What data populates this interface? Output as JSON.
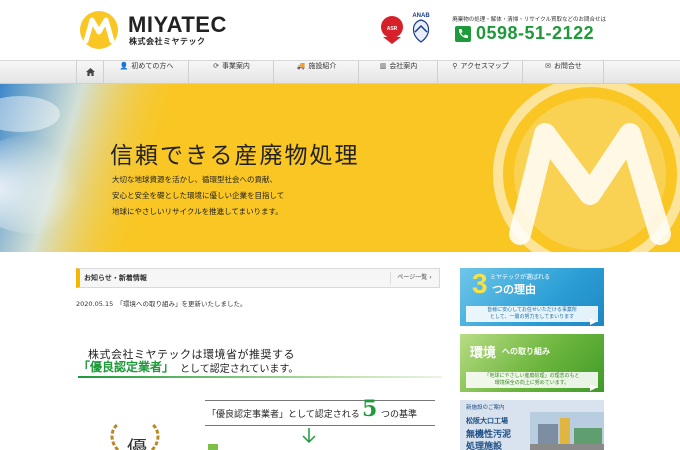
{
  "header": {
    "logo_name": "MIYATEC",
    "logo_sub": "株式会社ミヤテック",
    "badge_asr": "ASR",
    "badge_anab": "ANAB",
    "contact_note": "廃棄物の処理・解体・清掃・リサイクル買取などのお問合せは",
    "phone": "0598-51-2122"
  },
  "nav": {
    "items": [
      {
        "label": "初めての方へ",
        "icon": "user-icon",
        "glyph": "👤"
      },
      {
        "label": "事業案内",
        "icon": "refresh-icon",
        "glyph": "⟳"
      },
      {
        "label": "施設紹介",
        "icon": "truck-icon",
        "glyph": "🚚"
      },
      {
        "label": "会社案内",
        "icon": "building-icon",
        "glyph": "▥"
      },
      {
        "label": "アクセスマップ",
        "icon": "map-marker-icon",
        "glyph": "⚲"
      },
      {
        "label": "お問合せ",
        "icon": "mail-icon",
        "glyph": "✉"
      }
    ]
  },
  "hero": {
    "title": "信頼できる産廃物処理",
    "lines": [
      "大切な地球資源を活かし、循環型社会への貢献、",
      "安心と安全を礎とした環境に優しい企業を目指して",
      "地球にやさしいリサイクルを推進してまいります。"
    ]
  },
  "news": {
    "title": "お知らせ・新着情報",
    "more": "ページ一覧",
    "entry": "2020.05.15　「環境への取り組み」を更新いたしました。"
  },
  "certified": {
    "line1": "株式会社ミヤテックは環境省が推奨する",
    "highlight": "「優良認定業者」",
    "rest": "として認定されています。",
    "five_text": "「優良認定事業者」として認定される",
    "five_num": "5",
    "five_tail": "つの基準",
    "medal_char": "優"
  },
  "sidebar": {
    "banner1": {
      "top": "ミヤテックが選ばれる",
      "num": "3",
      "tail": "つの理由",
      "cap1": "皆様に安心してお任せいただける事業所",
      "cap2": "として、一層の努力をしてまいります"
    },
    "banner2": {
      "title": "環境",
      "tail": "への取り組み",
      "cap1": "「地球にやさしい産廃処理」の理念のもと",
      "cap2": "環境保全の向上に努めています。"
    },
    "banner3": {
      "top": "新施設のご案内",
      "l1": "松阪大口工場",
      "l2": "無機性汚泥",
      "l3": "処理施設"
    }
  },
  "colors": {
    "brand_yellow": "#f9c623",
    "brand_green": "#1e9a3a",
    "blue_banner": "#2d9fd6",
    "green_banner": "#6bb53c"
  }
}
